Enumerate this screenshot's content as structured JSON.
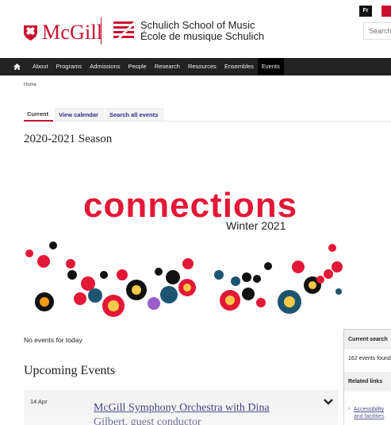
{
  "header": {
    "university": "McGill",
    "school_en": "Schulich School of Music",
    "school_fr": "École de musique Schulich",
    "lang_toggle": "Fr",
    "search_placeholder": "Search",
    "brand_color": "#c8102e"
  },
  "nav": {
    "home_icon": "home-icon",
    "items": [
      "About",
      "Programs",
      "Admissions",
      "People",
      "Research",
      "Resources",
      "Ensembles",
      "Events"
    ],
    "active": "Events"
  },
  "breadcrumb": "Home",
  "tabs": [
    "Current",
    "View calendar",
    "Search all events"
  ],
  "season_title": "2020-2021 Season",
  "banner": {
    "title": "connections",
    "subtitle": "Winter 2021"
  },
  "no_events": "No events for today",
  "upcoming_heading": "Upcoming Events",
  "event": {
    "date": "14 Apr",
    "title": "McGill Symphony Orchestra with Dina Gilbert, guest conductor"
  },
  "sidebar": {
    "current_search": "Current search",
    "count": "162 events found",
    "related": "Related links",
    "link": "Accessibility and facilities"
  }
}
